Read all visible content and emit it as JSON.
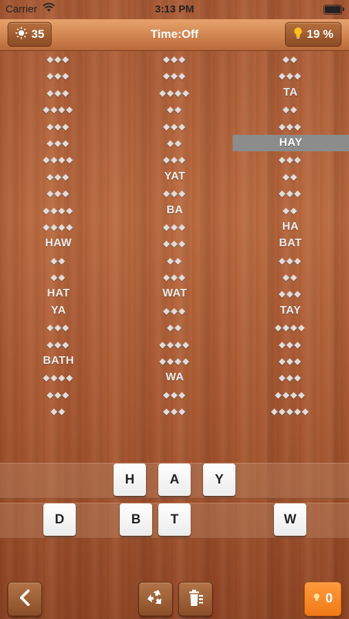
{
  "status": {
    "carrier": "Carrier",
    "time": "3:13 PM"
  },
  "header": {
    "score": "35",
    "timer": "Time:Off",
    "percent": "19 %"
  },
  "columns": [
    [
      "◆◆◆",
      "◆◆◆",
      "◆◆◆",
      "◆◆◆◆",
      "◆◆◆",
      "◆◆◆",
      "◆◆◆◆",
      "◆◆◆",
      "◆◆◆",
      "◆◆◆◆",
      "◆◆◆◆",
      "HAW",
      "◆◆",
      "◆◆",
      "HAT",
      "YA",
      "◆◆◆",
      "◆◆◆",
      "BATH",
      "◆◆◆◆",
      "◆◆◆",
      "◆◆"
    ],
    [
      "◆◆◆",
      "◆◆◆",
      "◆◆◆◆",
      "◆◆",
      "◆◆◆",
      "◆◆",
      "◆◆◆",
      "YAT",
      "◆◆◆",
      "BA",
      "◆◆◆",
      "◆◆◆",
      "◆◆",
      "◆◆◆",
      "WAT",
      "◆◆◆",
      "◆◆",
      "◆◆◆◆",
      "◆◆◆◆",
      "WA",
      "◆◆◆",
      "◆◆◆"
    ],
    [
      "◆◆",
      "◆◆◆",
      "TA",
      "◆◆",
      "◆◆◆",
      "HAY",
      "◆◆◆",
      "◆◆",
      "◆◆◆",
      "◆◆",
      "HA",
      "BAT",
      "◆◆◆",
      "◆◆",
      "◆◆◆",
      "TAY",
      "◆◆◆◆",
      "◆◆◆",
      "◆◆◆",
      "◆◆◆",
      "◆◆◆◆",
      "◆◆◆◆◆"
    ]
  ],
  "selected_word": "HAY",
  "answer_tiles": [
    "H",
    "A",
    "Y"
  ],
  "letter_tiles": [
    "D",
    "B",
    "T",
    "W"
  ],
  "footer": {
    "hint_count": "0"
  }
}
